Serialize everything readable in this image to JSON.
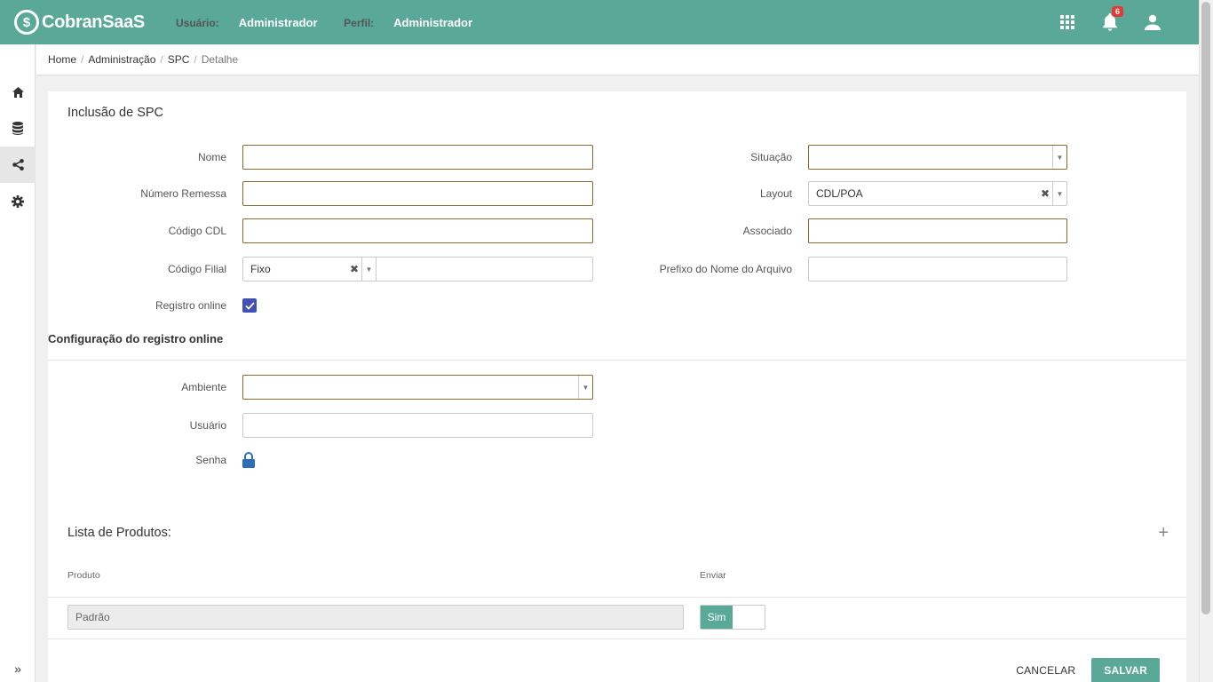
{
  "app": {
    "name": "CobranSaaS",
    "logo_glyph": "$"
  },
  "header": {
    "user_label": "Usuário:",
    "user_value": "Administrador",
    "profile_label": "Perfil:",
    "profile_value": "Administrador",
    "notifications_count": "6"
  },
  "sidebar": {
    "items": [
      "home-icon",
      "database-icon",
      "share-icon",
      "gear-icon"
    ],
    "expand_glyph": "»"
  },
  "breadcrumb": {
    "items": [
      "Home",
      "Administração",
      "SPC"
    ],
    "current": "Detalhe",
    "separator": "/"
  },
  "form": {
    "title": "Inclusão de SPC",
    "nome_label": "Nome",
    "nome_value": "",
    "numero_remessa_label": "Número Remessa",
    "numero_remessa_value": "",
    "codigo_cdl_label": "Código CDL",
    "codigo_cdl_value": "",
    "codigo_filial_label": "Código Filial",
    "codigo_filial_select": "Fixo",
    "codigo_filial_value": "",
    "registro_online_label": "Registro online",
    "registro_online_checked": true,
    "situacao_label": "Situação",
    "situacao_value": "",
    "layout_label": "Layout",
    "layout_value": "CDL/POA",
    "associado_label": "Associado",
    "associado_value": "",
    "prefixo_label": "Prefixo do Nome do Arquivo",
    "prefixo_value": ""
  },
  "online_config": {
    "title": "Configuração do registro online",
    "ambiente_label": "Ambiente",
    "ambiente_value": "",
    "usuario_label": "Usuário",
    "usuario_value": "",
    "senha_label": "Senha"
  },
  "products": {
    "title": "Lista de Produtos:",
    "col_produto": "Produto",
    "col_enviar": "Enviar",
    "rows": [
      {
        "produto": "Padrão",
        "enviar": "Sim"
      }
    ]
  },
  "actions": {
    "cancel": "CANCELAR",
    "save": "SALVAR"
  },
  "colors": {
    "primary": "#5aa898",
    "required_border": "#8a6a2e",
    "checkbox": "#3f51b5",
    "badge": "#e53935",
    "lock": "#2f6db5"
  }
}
